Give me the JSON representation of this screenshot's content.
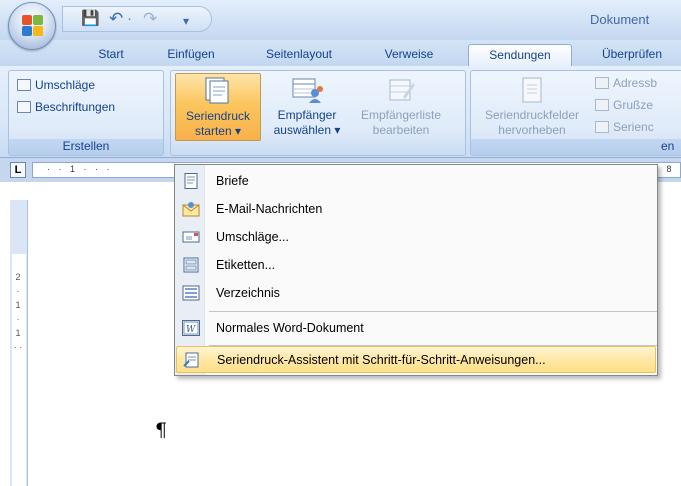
{
  "title_bar": {
    "doc_title": "Dokument",
    "qat_symbols": [
      "💾",
      "↶",
      "·",
      "↷",
      "▾"
    ]
  },
  "tabs": [
    {
      "label": "Start",
      "active": false
    },
    {
      "label": "Einfügen",
      "active": false
    },
    {
      "label": "Seitenlayout",
      "active": false
    },
    {
      "label": "Verweise",
      "active": false
    },
    {
      "label": "Sendungen",
      "active": true
    },
    {
      "label": "Überprüfen",
      "active": false
    }
  ],
  "ribbon": {
    "erstellen": {
      "label": "Erstellen",
      "umschlaege": "Umschläge",
      "beschriftungen": "Beschriftungen"
    },
    "seriendruck_starten": {
      "line1": "Seriendruck",
      "line2": "starten ▾"
    },
    "empfaenger_auswaehlen": {
      "line1": "Empfänger",
      "line2": "auswählen ▾"
    },
    "empfaengerliste_bearbeiten": {
      "line1": "Empfängerliste",
      "line2": "bearbeiten"
    },
    "seriendruckfelder_hervorheben": {
      "line1": "Seriendruckfelder",
      "line2": "hervorheben"
    },
    "right_items": [
      "Adressb",
      "Grußze",
      "Serienc"
    ],
    "partial_group_label": "en"
  },
  "ruler": {
    "corner": "L",
    "h_text": "· · 1 · · ·",
    "h_right": "· 8",
    "v_text": "2 · 1 · 1 · ·"
  },
  "menu": {
    "items": [
      {
        "label": "Briefe",
        "icon": "letter-icon"
      },
      {
        "label": "E-Mail-Nachrichten",
        "icon": "email-icon"
      },
      {
        "label": "Umschläge...",
        "icon": "envelope-icon"
      },
      {
        "label": "Etiketten...",
        "icon": "labels-icon"
      },
      {
        "label": "Verzeichnis",
        "icon": "directory-icon"
      },
      {
        "label": "Normales Word-Dokument",
        "icon": "word-document-icon"
      },
      {
        "label": "Seriendruck-Assistent mit Schritt-für-Schritt-Anweisungen...",
        "icon": "wizard-icon",
        "highlighted": true
      }
    ]
  },
  "document": {
    "paragraph_mark": "¶"
  },
  "colors": {
    "ribbon_text": "#15428b",
    "highlight": "#ffe8a6",
    "pressed_button": "#fbc65e"
  }
}
